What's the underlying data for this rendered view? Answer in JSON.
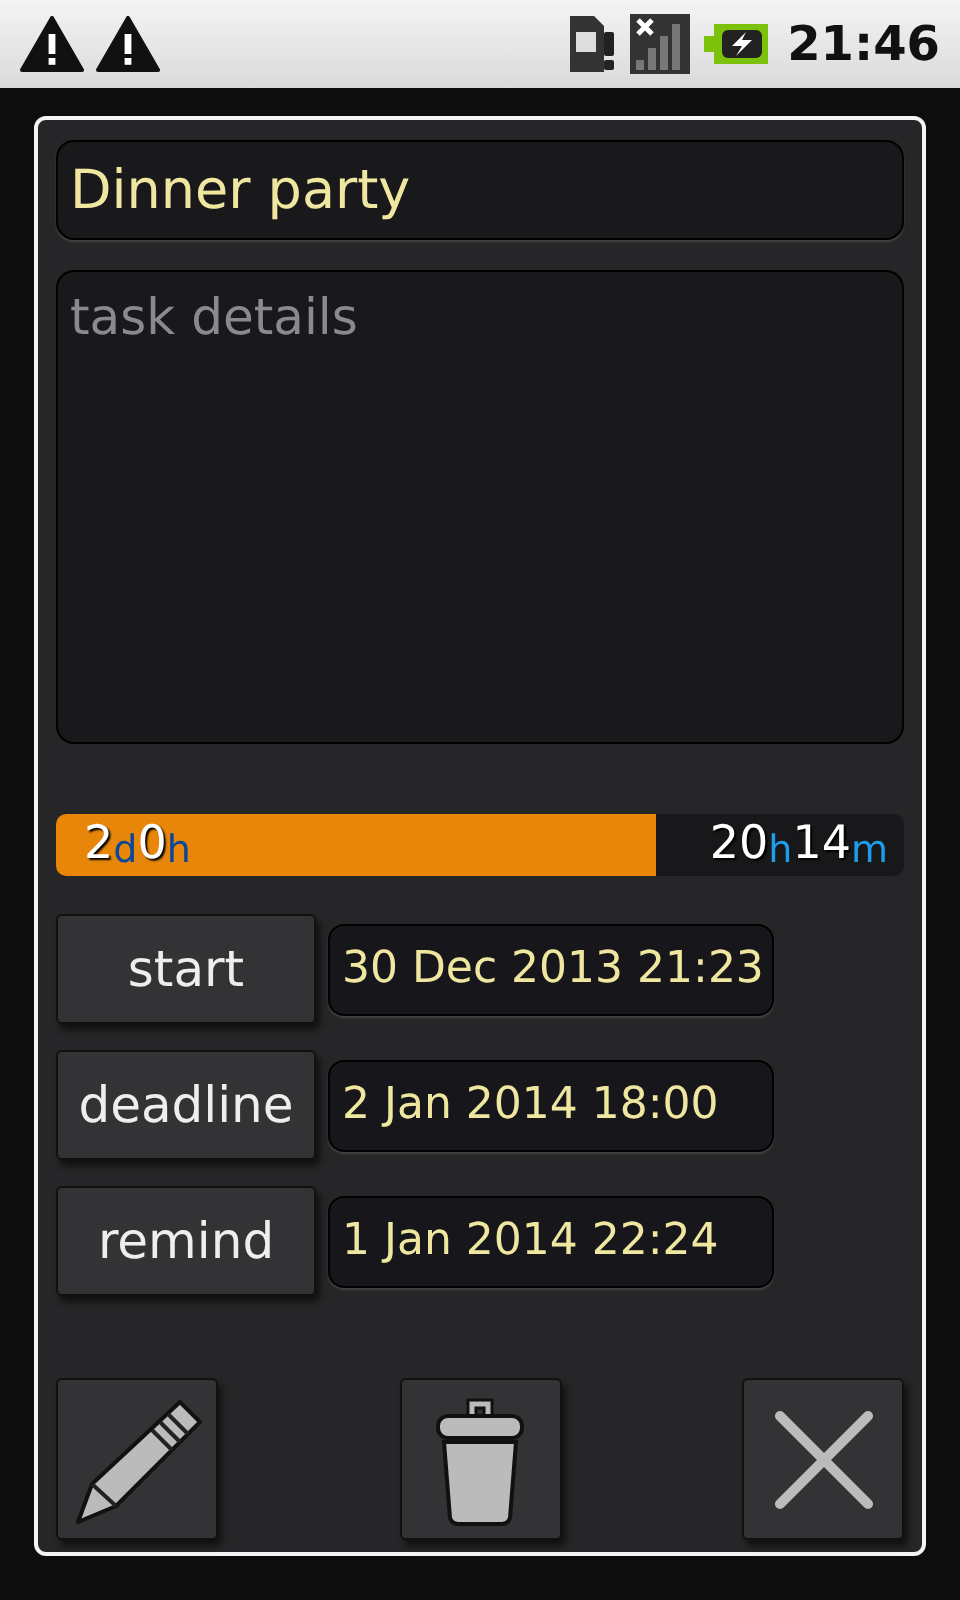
{
  "status_bar": {
    "time": "21:46"
  },
  "task": {
    "title": "Dinner party",
    "details_placeholder": "task details"
  },
  "progress": {
    "level": 0.708,
    "elapsed": [
      {
        "text": "2",
        "kind": "number"
      },
      {
        "text": "d",
        "kind": "unit"
      },
      {
        "text": "0",
        "kind": "number"
      },
      {
        "text": "h",
        "kind": "unit"
      }
    ],
    "remaining": [
      {
        "text": "20",
        "kind": "number"
      },
      {
        "text": "h",
        "kind": "unit"
      },
      {
        "text": "14",
        "kind": "number"
      },
      {
        "text": "m",
        "kind": "unit"
      }
    ]
  },
  "dates": [
    {
      "label": "start",
      "value": "30 Dec 2013 21:23"
    },
    {
      "label": "deadline",
      "value": "2 Jan 2014 18:00"
    },
    {
      "label": "remind",
      "value": "1 Jan 2014 22:24"
    }
  ],
  "actions": [
    {
      "kind": "edit"
    },
    {
      "kind": "delete"
    },
    {
      "kind": "close"
    }
  ]
}
